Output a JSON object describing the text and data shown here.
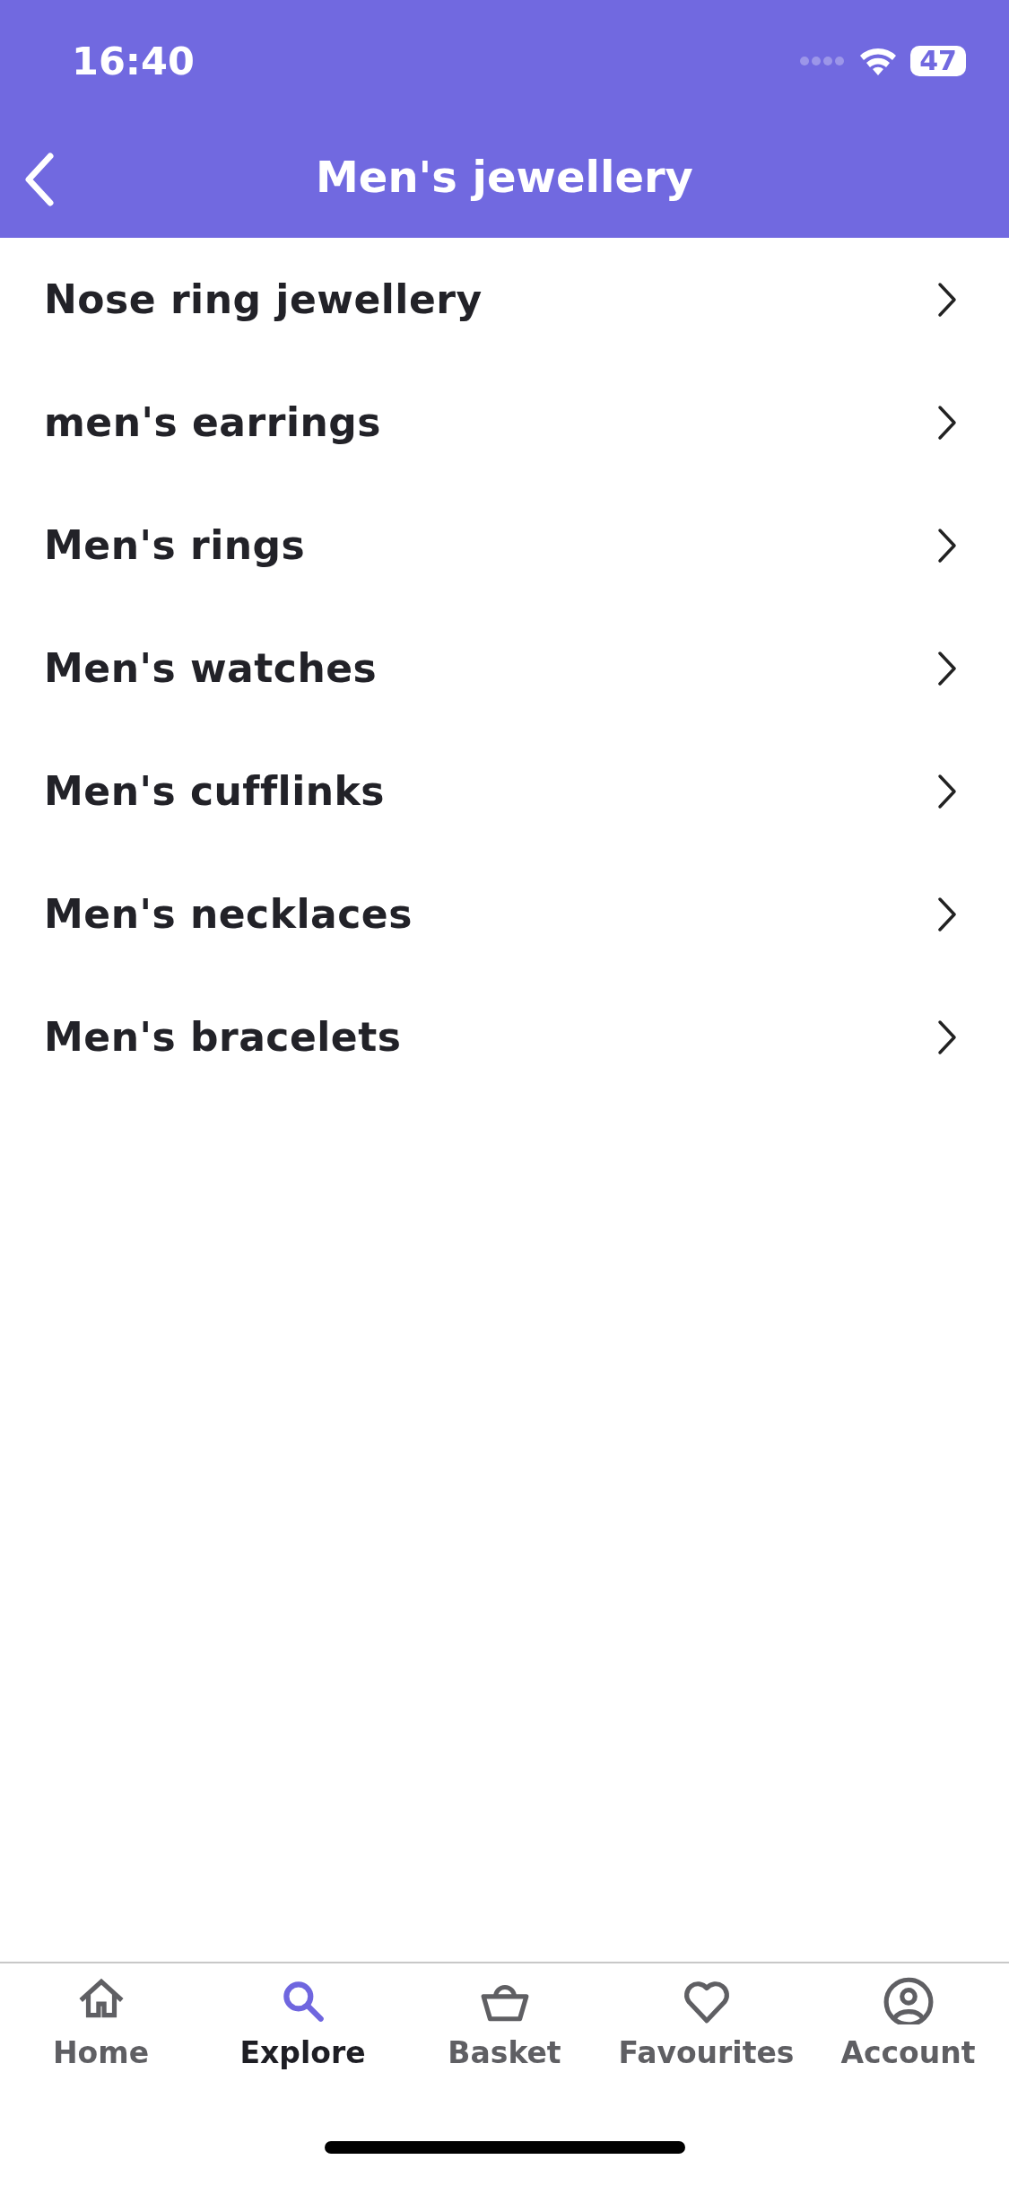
{
  "status_bar": {
    "time": "16:40",
    "battery": "47"
  },
  "header": {
    "title": "Men's jewellery"
  },
  "categories": [
    {
      "label": "Nose ring jewellery"
    },
    {
      "label": "men's earrings"
    },
    {
      "label": "Men's rings"
    },
    {
      "label": "Men's watches"
    },
    {
      "label": "Men's cufflinks"
    },
    {
      "label": "Men's necklaces"
    },
    {
      "label": "Men's bracelets"
    }
  ],
  "tab_bar": [
    {
      "label": "Home",
      "kind": "home",
      "selected": false
    },
    {
      "label": "Explore",
      "kind": "search",
      "selected": true
    },
    {
      "label": "Basket",
      "kind": "basket",
      "selected": false
    },
    {
      "label": "Favourites",
      "kind": "heart",
      "selected": false
    },
    {
      "label": "Account",
      "kind": "account",
      "selected": false
    }
  ]
}
